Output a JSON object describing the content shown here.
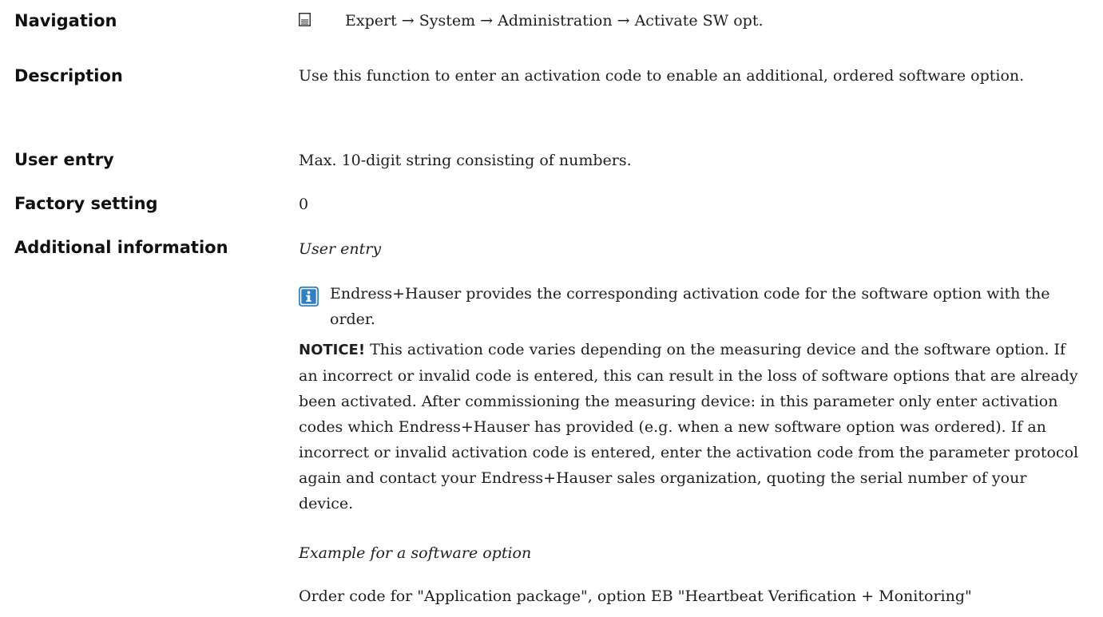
{
  "navigation": {
    "label": "Navigation",
    "icon": "menu-icon",
    "path": "Expert → System → Administration → Activate SW opt."
  },
  "description": {
    "label": "Description",
    "text": "Use this function to enter an activation code to enable an additional, ordered software option."
  },
  "user_entry": {
    "label": "User entry",
    "text": "Max. 10-digit string consisting of numbers."
  },
  "factory_setting": {
    "label": "Factory setting",
    "value": "0"
  },
  "additional_info": {
    "label": "Additional information",
    "subheading": "User entry",
    "info_icon": "info-icon",
    "info_text": "Endress+Hauser provides the corresponding activation code for the software option with the order.",
    "notice_word": "NOTICE!",
    "notice_text": " This activation code varies depending on the measuring device and the software option. If an incorrect or invalid code is entered, this can result in the loss of software options that are already been activated. After commissioning the measuring device: in this parameter only enter activation codes which Endress+Hauser has provided (e.g. when a new software option was ordered). If an incorrect or invalid activation code is entered, enter the activation code from the parameter protocol again and contact your Endress+Hauser sales organization, quoting the serial number of your device.",
    "example_heading": "Example for a software option",
    "example_text": "Order code for \"Application package\", option EB \"Heartbeat Verification + Monitoring\""
  },
  "colors": {
    "info_icon_bg": "#2f7fc1",
    "text": "#1e1e1e"
  }
}
